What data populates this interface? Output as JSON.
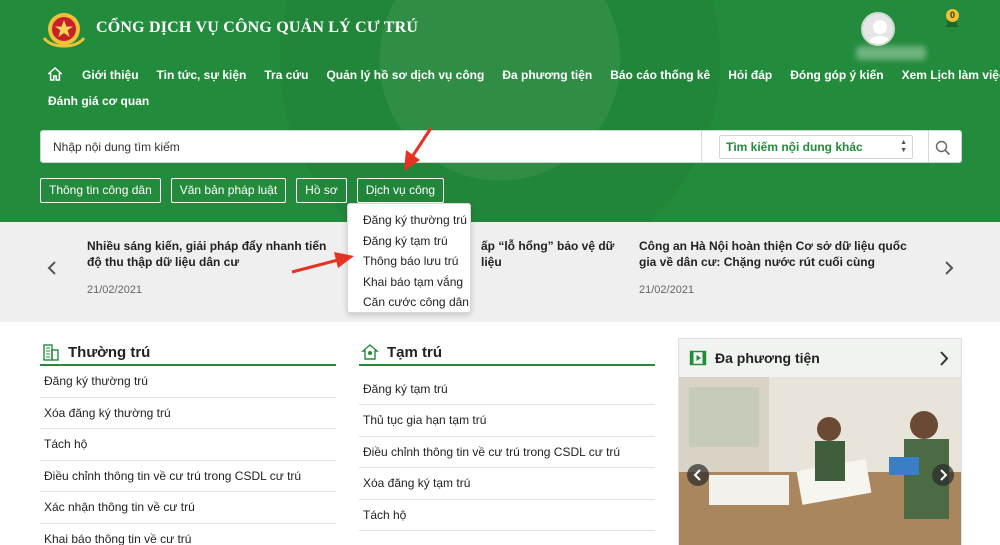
{
  "header": {
    "site_title": "CỔNG DỊCH VỤ CÔNG QUẢN LÝ CƯ TRÚ",
    "notification_count": "0"
  },
  "nav": {
    "row1": [
      "Giới thiệu",
      "Tin tức, sự kiện",
      "Tra cứu",
      "Quản lý hồ sơ dịch vụ công",
      "Đa phương tiện",
      "Báo cáo thống kê",
      "Hỏi đáp",
      "Đóng góp ý kiến",
      "Xem Lịch làm việc"
    ],
    "row2": [
      "Đánh giá cơ quan"
    ]
  },
  "search": {
    "placeholder": "Nhập nội dung tìm kiếm",
    "select_value": "Tìm kiếm nội dung khác"
  },
  "tabs": [
    "Thông tin công dân",
    "Văn bản pháp luật",
    "Hồ sơ",
    "Dịch vụ công"
  ],
  "dropdown": {
    "items": [
      "Đăng ký thường trú",
      "Đăng ký tạm trú",
      "Thông báo lưu trú",
      "Khai báo tạm vắng",
      "Căn cước công dân"
    ]
  },
  "news": [
    {
      "title": "Nhiều sáng kiến, giải pháp đẩy nhanh tiến độ thu thập dữ liệu dân cư",
      "date": "21/02/2021"
    },
    {
      "title": "ấp “lỗ hổng” bảo vệ dữ liệu",
      "date": ""
    },
    {
      "title": "Công an Hà Nội hoàn thiện Cơ sở dữ liệu quốc gia về dân cư: Chặng nước rút cuối cùng",
      "date": "21/02/2021"
    }
  ],
  "columns": {
    "thuong_tru": {
      "title": "Thường trú",
      "items": [
        "Đăng ký thường trú",
        "Xóa đăng ký thường trú",
        "Tách hộ",
        "Điều chỉnh thông tin về cư trú trong CSDL cư trú",
        "Xác nhận thông tin về cư trú",
        "Khai báo thông tin về cư trú"
      ]
    },
    "tam_tru": {
      "title": "Tạm trú",
      "items": [
        "Đăng ký tạm trú",
        "Thủ tục gia hạn tạm trú",
        "Điều chỉnh thông tin về cư trú trong CSDL cư trú",
        "Xóa đăng ký tạm trú",
        "Tách hộ"
      ]
    },
    "media": {
      "title": "Đa phương tiện"
    }
  },
  "colors": {
    "brand_green": "#238b3c",
    "annotation_red": "#e53222"
  }
}
